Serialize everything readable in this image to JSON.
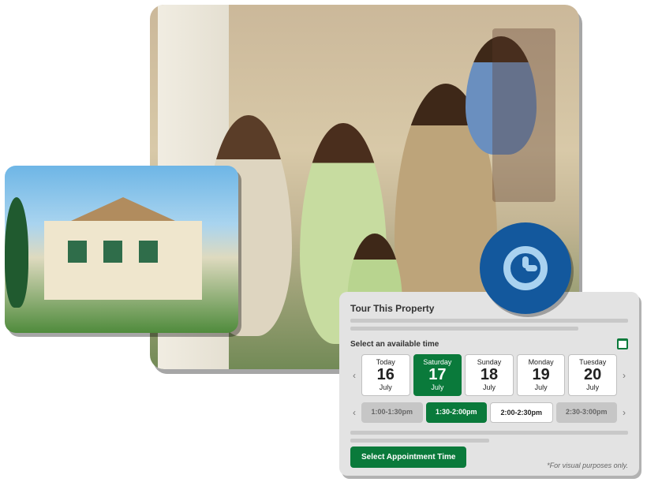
{
  "booking": {
    "title": "Tour This Property",
    "select_time_label": "Select an available time",
    "dates": [
      {
        "dow": "Today",
        "day": "16",
        "month": "July",
        "selected": false
      },
      {
        "dow": "Saturday",
        "day": "17",
        "month": "July",
        "selected": true
      },
      {
        "dow": "Sunday",
        "day": "18",
        "month": "July",
        "selected": false
      },
      {
        "dow": "Monday",
        "day": "19",
        "month": "July",
        "selected": false
      },
      {
        "dow": "Tuesday",
        "day": "20",
        "month": "July",
        "selected": false
      }
    ],
    "times": [
      {
        "label": "1:00-1:30pm",
        "state": "disabled"
      },
      {
        "label": "1:30-2:00pm",
        "state": "selected"
      },
      {
        "label": "2:00-2:30pm",
        "state": "available"
      },
      {
        "label": "2:30-3:00pm",
        "state": "disabled"
      }
    ],
    "submit_label": "Select Appointment Time",
    "disclaimer": "*For visual purposes only."
  },
  "icons": {
    "clock": "clock-icon",
    "calendar": "calendar-icon",
    "chevron_left": "‹",
    "chevron_right": "›"
  },
  "colors": {
    "brand_green": "#0a7a3b",
    "brand_blue": "#13589d",
    "clock_face": "#a9d2f0",
    "panel_bg": "#e3e3e3"
  }
}
